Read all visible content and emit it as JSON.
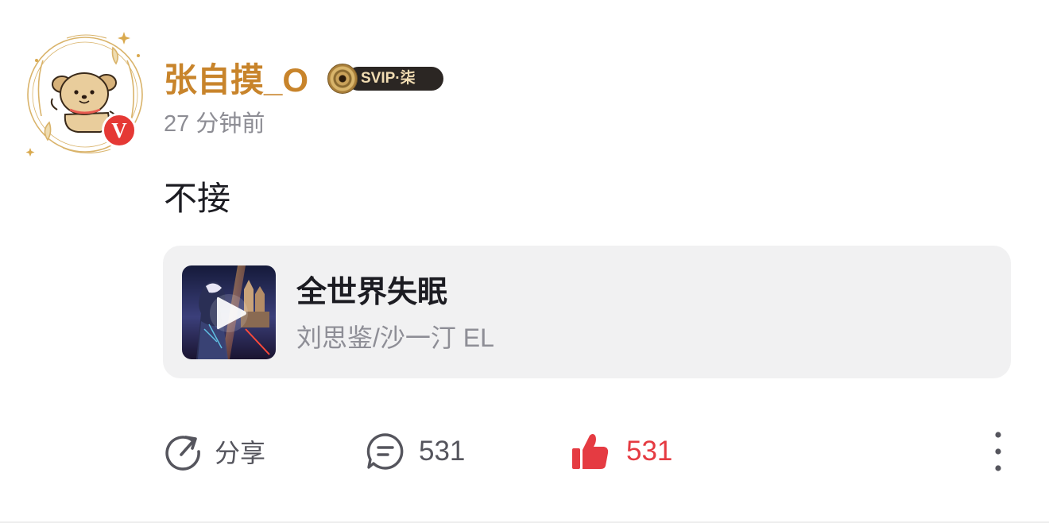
{
  "post": {
    "author": {
      "username": "张自摸_O",
      "verified_badge": "V",
      "vip_label": "SVIP·柒",
      "avatar_icon": "cartoon-dog-avatar",
      "vip_icon": "vinyl-disc-icon"
    },
    "timestamp": "27 分钟前",
    "text": "不接",
    "music": {
      "title": "全世界失眠",
      "artist": "刘思鉴/沙一汀 EL",
      "play_icon": "play-icon"
    },
    "actions": {
      "share_label": "分享",
      "comment_count": "531",
      "like_count": "531",
      "share_icon": "share-arrow-icon",
      "comment_icon": "comment-bubble-icon",
      "like_icon": "thumbs-up-icon",
      "more_icon": "more-vertical-icon"
    }
  },
  "colors": {
    "username": "#c8842b",
    "like": "#e53b42",
    "badge": "#e53935",
    "card_bg": "#f1f1f2",
    "muted_text": "#8d8d94"
  }
}
